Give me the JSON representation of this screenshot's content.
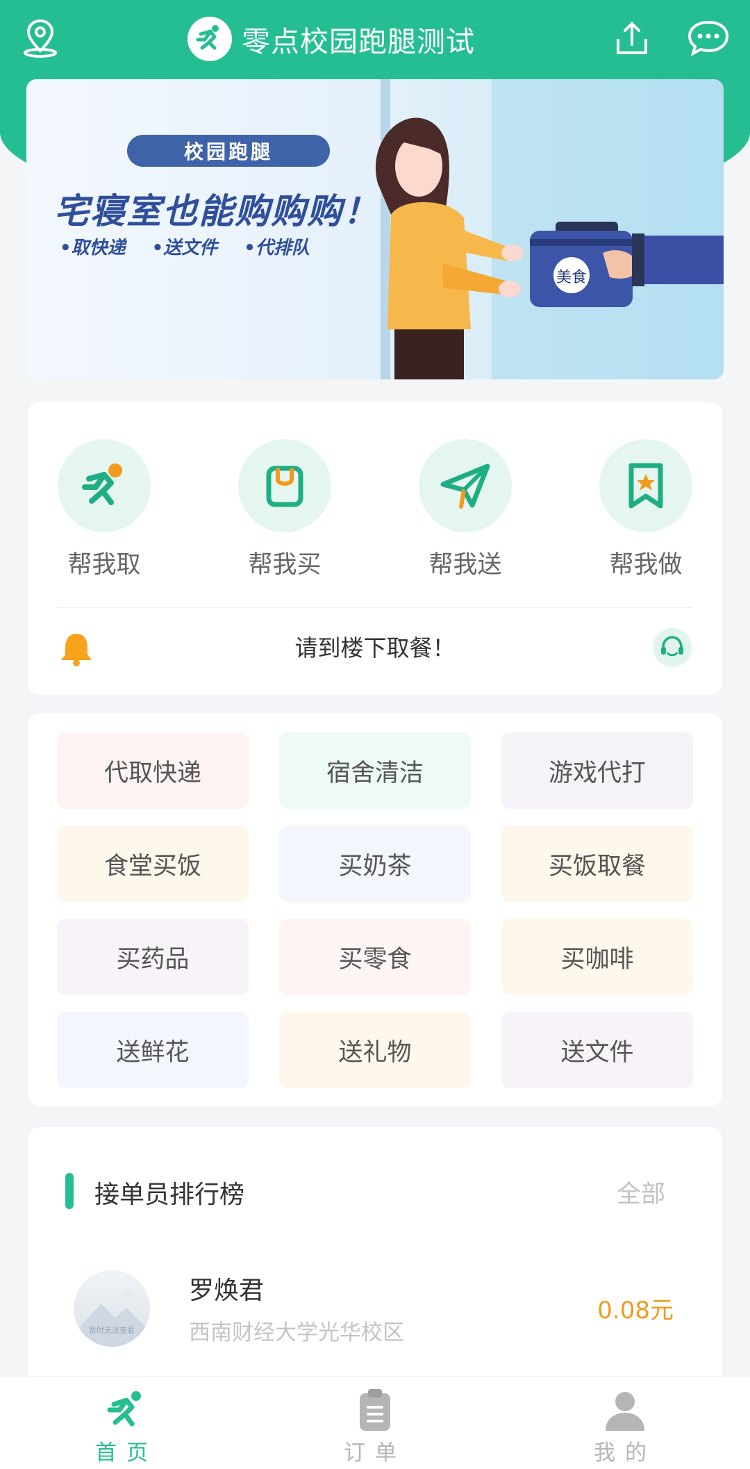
{
  "header": {
    "title": "零点校园跑腿测试",
    "icons": [
      "location-icon",
      "runner-logo-icon",
      "share-icon",
      "chat-icon"
    ],
    "brand_color": "#24be92"
  },
  "banner": {
    "tag": "校园跑腿",
    "slogan": "宅寝室也能购购购！",
    "bullets": [
      "•取快递",
      "•送文件",
      "•代排队"
    ],
    "box_label": "美食"
  },
  "services": [
    {
      "label": "帮我取",
      "icon": "runner-icon"
    },
    {
      "label": "帮我买",
      "icon": "shopping-bag-icon"
    },
    {
      "label": "帮我送",
      "icon": "paper-plane-icon"
    },
    {
      "label": "帮我做",
      "icon": "star-bookmark-icon"
    }
  ],
  "notice": {
    "text": "请到楼下取餐！",
    "icons": [
      "bell-icon",
      "customer-service-icon"
    ]
  },
  "tags": [
    {
      "label": "代取快递",
      "color": "#fdf3f3"
    },
    {
      "label": "宿舍清洁",
      "color": "#eefaf3"
    },
    {
      "label": "游戏代打",
      "color": "#f6f3f8"
    },
    {
      "label": "食堂买饭",
      "color": "#fef8ec"
    },
    {
      "label": "买奶茶",
      "color": "#f3f6fc"
    },
    {
      "label": "买饭取餐",
      "color": "#fef8ec"
    },
    {
      "label": "买药品",
      "color": "#f7f3f9"
    },
    {
      "label": "买零食",
      "color": "#fdf4f4"
    },
    {
      "label": "买咖啡",
      "color": "#fef8ec"
    },
    {
      "label": "送鲜花",
      "color": "#f3f6fc"
    },
    {
      "label": "送礼物",
      "color": "#fef8ec"
    },
    {
      "label": "送文件",
      "color": "#f7f3f9"
    }
  ],
  "ranking": {
    "title": "接单员排行榜",
    "all_label": "全部",
    "items": [
      {
        "name": "罗焕君",
        "school": "西南财经大学光华校区",
        "amount": "0.08元",
        "avatar_caption": "暂时无法查看"
      }
    ]
  },
  "bottom_nav": [
    {
      "label": "首页",
      "icon": "home-runner-icon",
      "active": true
    },
    {
      "label": "订单",
      "icon": "clipboard-icon",
      "active": false
    },
    {
      "label": "我的",
      "icon": "user-icon",
      "active": false
    }
  ],
  "colors": {
    "active_nav": "#24be92",
    "inactive_nav": "#b5b5b5",
    "amount": "#f29a1d"
  }
}
